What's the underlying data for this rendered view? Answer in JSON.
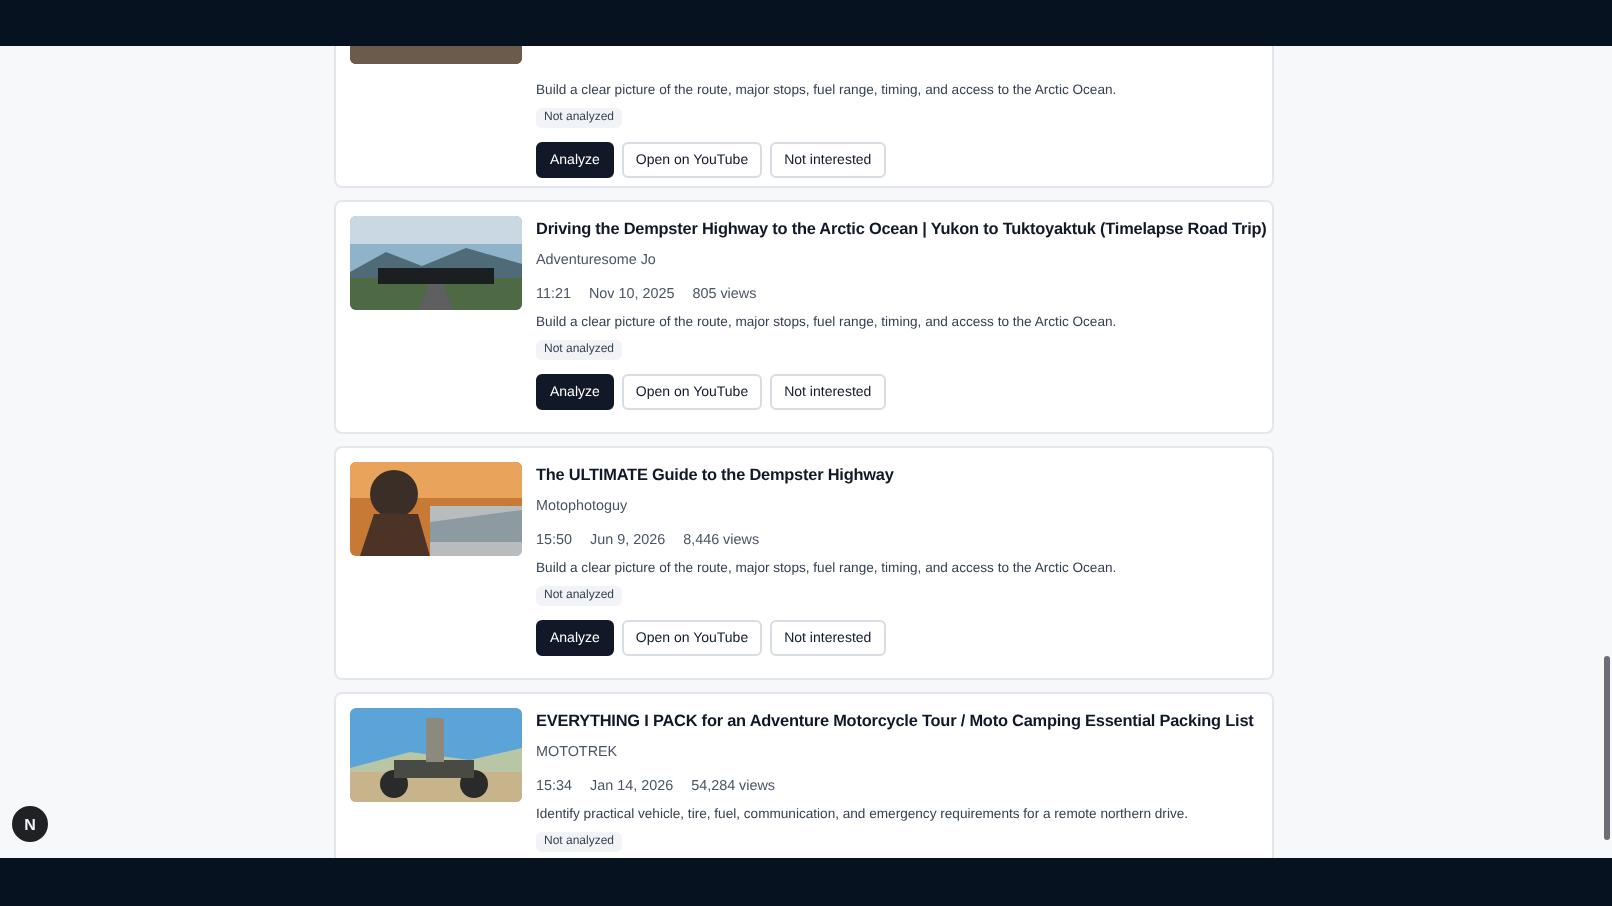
{
  "videos": [
    {
      "thumbnail": {
        "kind": "picture"
      },
      "description": "Build a clear picture of the route, major stops, fuel range, timing, and access to the Arctic Ocean.",
      "status": "Not analyzed",
      "actions": [
        {
          "label": "Analyze",
          "kind": "primary"
        },
        {
          "label": "Open on YouTube",
          "kind": "secondary"
        },
        {
          "label": "Not interested",
          "kind": "secondary"
        }
      ]
    },
    {
      "thumbnail": {
        "kind": "picture"
      },
      "title": "Driving the Dempster Highway to the Arctic Ocean | Yukon to Tuktoyaktuk (Timelapse Road Trip)",
      "channel": "Adventuresome Jo",
      "duration": "11:21",
      "date": "Nov 10, 2025",
      "views": "805 views",
      "description": "Build a clear picture of the route, major stops, fuel range, timing, and access to the Arctic Ocean.",
      "status": "Not analyzed",
      "actions": [
        {
          "label": "Analyze",
          "kind": "primary"
        },
        {
          "label": "Open on YouTube",
          "kind": "secondary"
        },
        {
          "label": "Not interested",
          "kind": "secondary"
        }
      ]
    },
    {
      "thumbnail": {
        "kind": "picture"
      },
      "title": "The ULTIMATE Guide to the Dempster Highway",
      "channel": "Motophotoguy",
      "duration": "15:50",
      "date": "Jun 9, 2026",
      "views": "8,446 views",
      "description": "Build a clear picture of the route, major stops, fuel range, timing, and access to the Arctic Ocean.",
      "status": "Not analyzed",
      "actions": [
        {
          "label": "Analyze",
          "kind": "primary"
        },
        {
          "label": "Open on YouTube",
          "kind": "secondary"
        },
        {
          "label": "Not interested",
          "kind": "secondary"
        }
      ]
    },
    {
      "thumbnail": {
        "kind": "picture"
      },
      "title": "EVERYTHING I PACK for an Adventure Motorcycle Tour / Moto Camping Essential Packing List",
      "channel": "MOTOTREK",
      "duration": "15:34",
      "date": "Jan 14, 2026",
      "views": "54,284 views",
      "description": "Identify practical vehicle, tire, fuel, communication, and emergency requirements for a remote northern drive.",
      "status": "Not analyzed"
    }
  ],
  "launcher": {
    "label": "N"
  }
}
